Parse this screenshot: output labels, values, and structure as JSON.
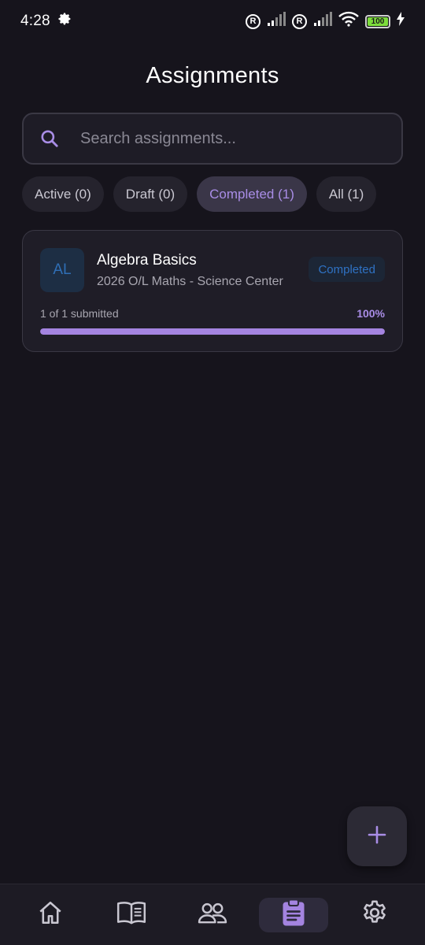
{
  "status_bar": {
    "time": "4:28",
    "battery": "100"
  },
  "page": {
    "title": "Assignments"
  },
  "search": {
    "placeholder": "Search assignments..."
  },
  "filters": [
    {
      "label": "Active (0)",
      "active": false
    },
    {
      "label": "Draft (0)",
      "active": false
    },
    {
      "label": "Completed (1)",
      "active": true
    },
    {
      "label": "All (1)",
      "active": false
    }
  ],
  "assignments": [
    {
      "initials": "AL",
      "title": "Algebra Basics",
      "subtitle": "2026 O/L Maths - Science Center",
      "status": "Completed",
      "submitted_text": "1 of 1 submitted",
      "progress_label": "100%",
      "progress": 1.0
    }
  ],
  "bottom_nav": [
    {
      "icon": "home-icon",
      "active": false
    },
    {
      "icon": "book-icon",
      "active": false
    },
    {
      "icon": "people-icon",
      "active": false
    },
    {
      "icon": "clipboard-icon",
      "active": true
    },
    {
      "icon": "gear-icon",
      "active": false
    }
  ],
  "colors": {
    "background": "#16141c",
    "accent": "#a484e0",
    "badge_blue": "#2f72c4"
  }
}
